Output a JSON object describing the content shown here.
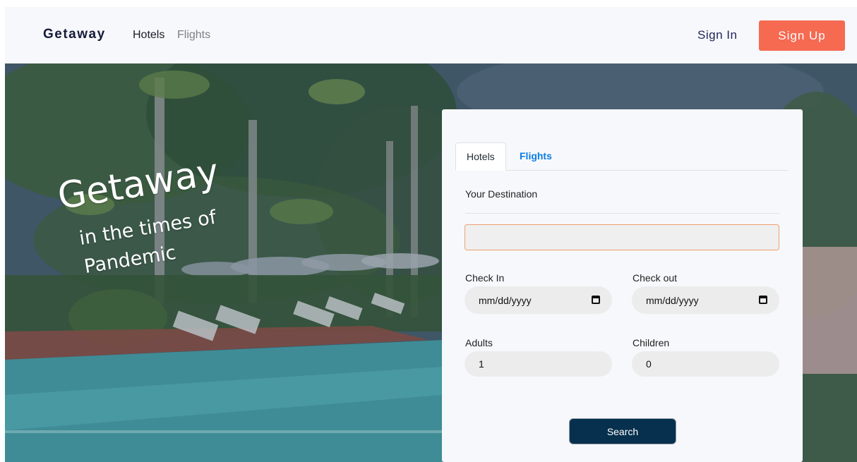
{
  "navbar": {
    "brand": "Getaway",
    "links": [
      "Hotels",
      "Flights"
    ],
    "sign_in": "Sign In",
    "sign_up": "Sign Up",
    "accent_color": "#f66a52"
  },
  "hero": {
    "title": "Getaway",
    "line2": "in the times of",
    "line3": "Pandemic"
  },
  "search_panel": {
    "tabs": [
      {
        "label": "Hotels",
        "active": true
      },
      {
        "label": "Flights",
        "active": false
      }
    ],
    "destination_label": "Your Destination",
    "destination_value": "",
    "check_in_label": "Check In",
    "check_in_value": "mm/dd/yyyy",
    "check_out_label": "Check out",
    "check_out_value": "mm/dd/yyyy",
    "adults_label": "Adults",
    "adults_value": "1",
    "children_label": "Children",
    "children_value": "0",
    "search_button": "Search",
    "button_color": "#06304d",
    "tab_link_color": "#0a7ee6"
  }
}
